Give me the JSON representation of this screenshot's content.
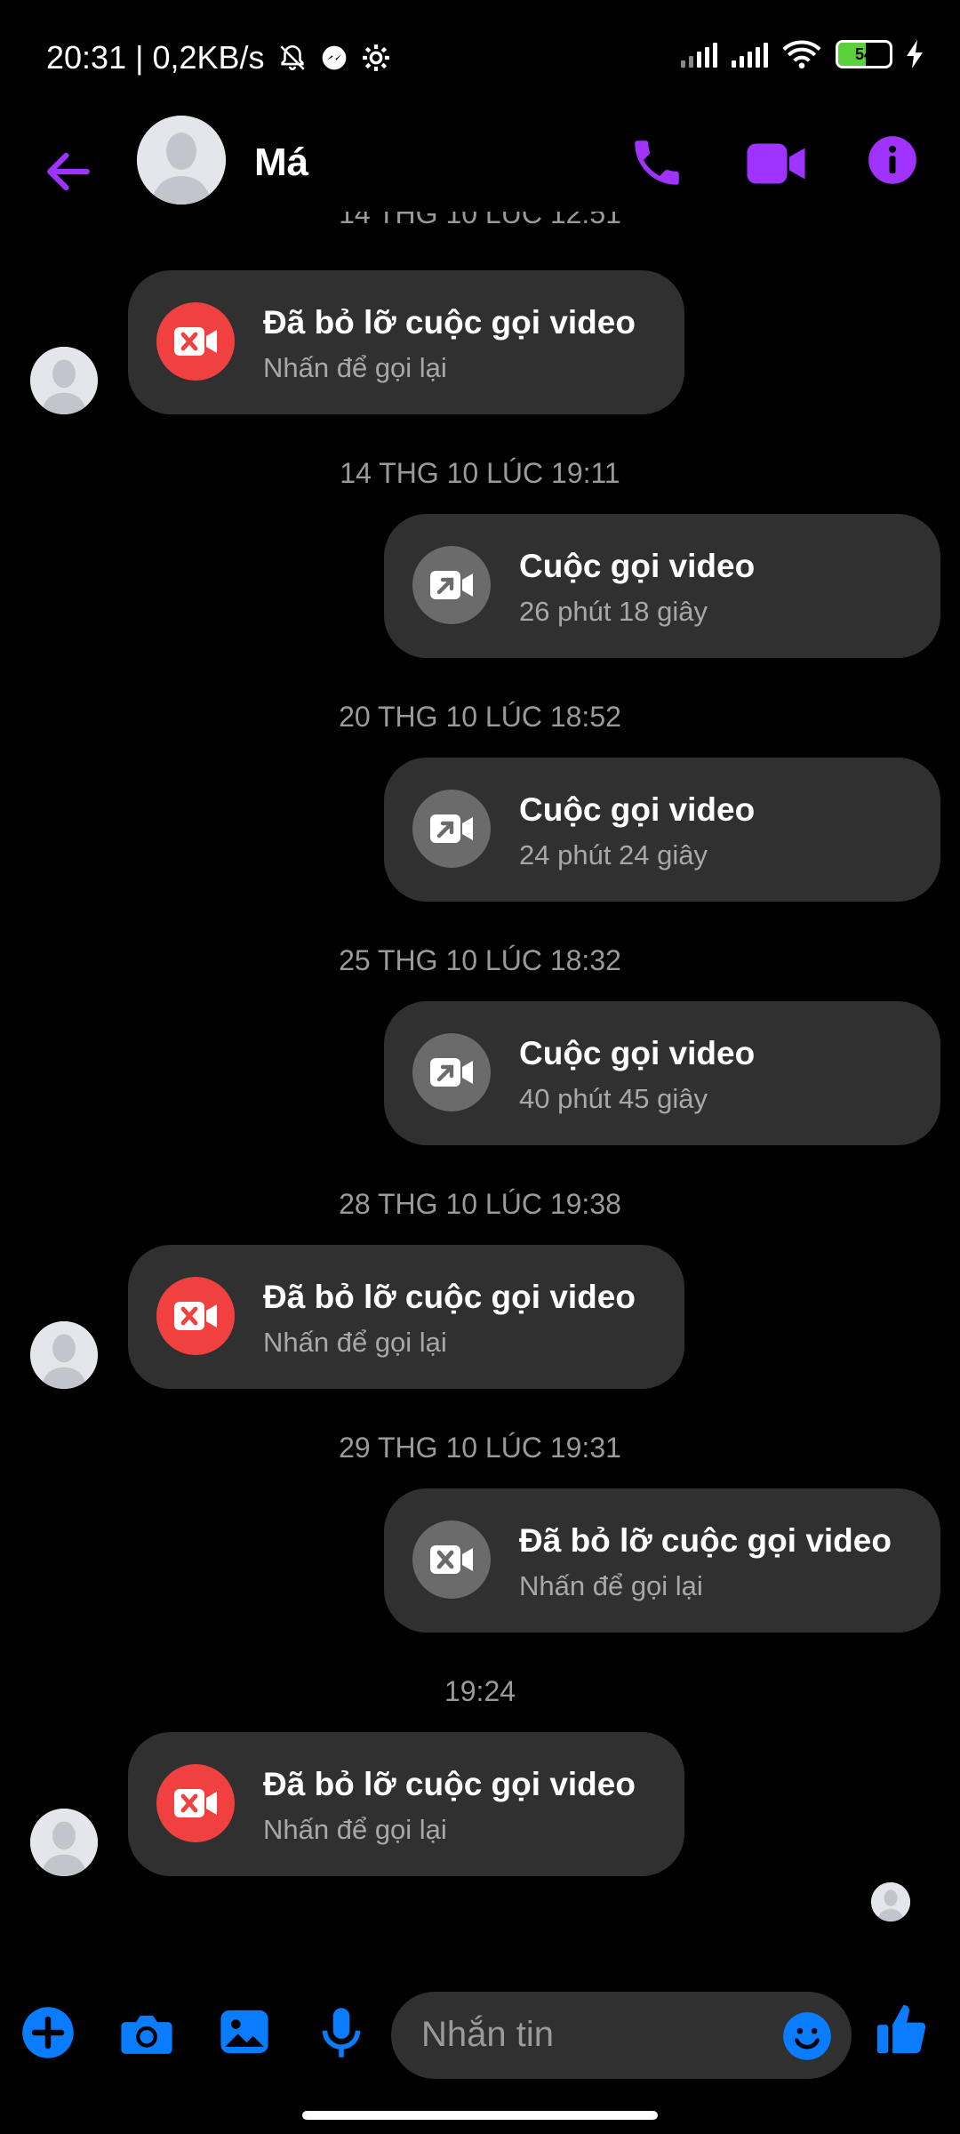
{
  "status": {
    "time_speed": "20:31 | 0,2KB/s",
    "battery": "54"
  },
  "header": {
    "contact_name": "Má"
  },
  "messages": [
    {
      "timestamp": "14 THG 10 LÚC 12:51",
      "title": "Đã bỏ lỡ cuộc gọi video",
      "subtitle": "Nhấn để gọi lại",
      "side": "left",
      "type": "missed"
    },
    {
      "timestamp": "14 THG 10 LÚC 19:11",
      "title": "Cuộc gọi video",
      "subtitle": "26 phút 18 giây",
      "side": "right",
      "type": "outgoing"
    },
    {
      "timestamp": "20 THG 10 LÚC 18:52",
      "title": "Cuộc gọi video",
      "subtitle": "24 phút 24 giây",
      "side": "right",
      "type": "outgoing"
    },
    {
      "timestamp": "25 THG 10 LÚC 18:32",
      "title": "Cuộc gọi video",
      "subtitle": "40 phút 45 giây",
      "side": "right",
      "type": "outgoing"
    },
    {
      "timestamp": "28 THG 10 LÚC 19:38",
      "title": "Đã bỏ lỡ cuộc gọi video",
      "subtitle": "Nhấn để gọi lại",
      "side": "left",
      "type": "missed"
    },
    {
      "timestamp": "29 THG 10 LÚC 19:31",
      "title": "Đã bỏ lỡ cuộc gọi video",
      "subtitle": "Nhấn để gọi lại",
      "side": "right",
      "type": "missed-outgoing"
    },
    {
      "timestamp": "19:24",
      "title": "Đã bỏ lỡ cuộc gọi video",
      "subtitle": "Nhấn để gọi lại",
      "side": "left",
      "type": "missed"
    }
  ],
  "composer": {
    "placeholder": "Nhắn tin"
  },
  "colors": {
    "accent_purple": "#a033ff",
    "accent_blue": "#0a7cff",
    "missed_red": "#f04040",
    "bubble_bg": "#303030"
  },
  "icons": [
    "back-arrow-icon",
    "phone-icon",
    "video-camera-icon",
    "info-icon",
    "missed-video-icon",
    "outgoing-video-icon",
    "plus-icon",
    "camera-icon",
    "gallery-icon",
    "mic-icon",
    "emoji-icon",
    "thumbs-up-icon"
  ]
}
